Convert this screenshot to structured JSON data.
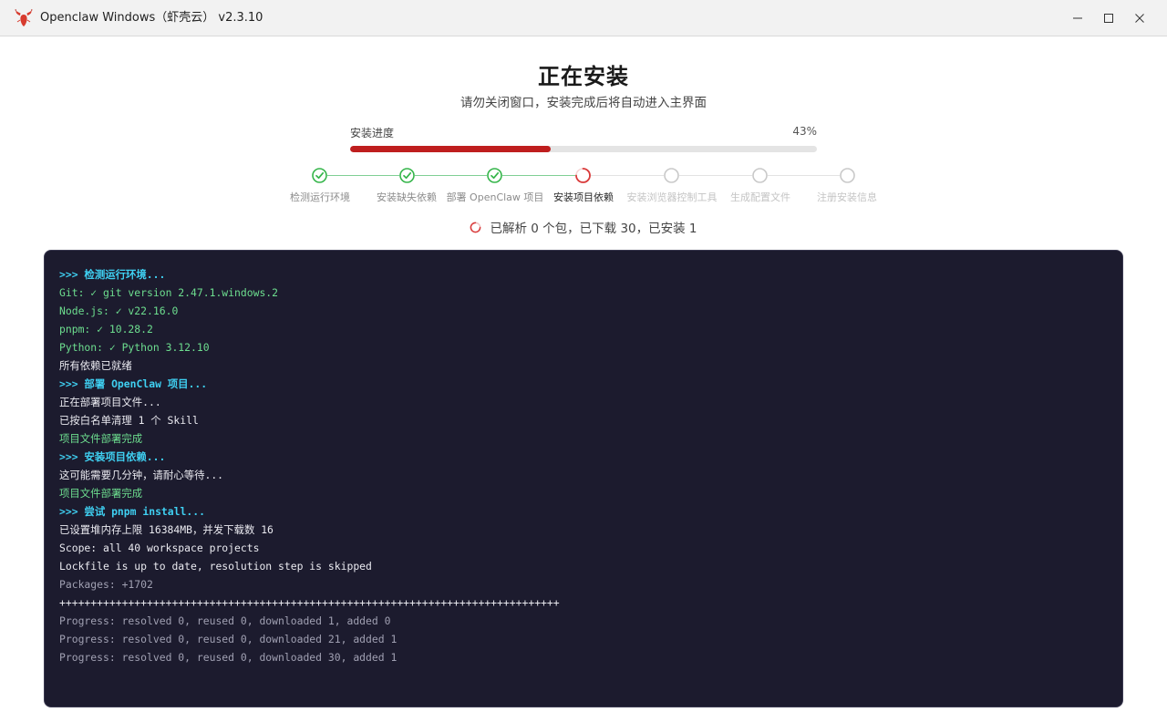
{
  "window": {
    "title": "Openclaw Windows（虾壳云） v2.3.10"
  },
  "header": {
    "title": "正在安装",
    "subtitle": "请勿关闭窗口，安装完成后将自动进入主界面"
  },
  "progress": {
    "label": "安装进度",
    "percent_text": "43%",
    "value": 0.43,
    "fill_color": "#bf1e1e"
  },
  "steps": [
    {
      "label": "检测运行环境",
      "status": "done"
    },
    {
      "label": "安装缺失依赖",
      "status": "done"
    },
    {
      "label": "部署 OpenClaw 项目",
      "status": "done"
    },
    {
      "label": "安装项目依赖",
      "status": "active"
    },
    {
      "label": "安装浏览器控制工具",
      "status": "pending"
    },
    {
      "label": "生成配置文件",
      "status": "pending"
    },
    {
      "label": "注册安装信息",
      "status": "pending"
    }
  ],
  "status_text": "已解析 0 个包，已下载 30，已安装 1",
  "colors": {
    "done": "#35b54a",
    "active": "#d93a3a",
    "pending": "#c9c9c9",
    "console_bg": "#1c1b2e"
  },
  "log": [
    {
      "text": ">>> 检测运行环境...",
      "style": "header"
    },
    {
      "text": "Git: ✓ git version 2.47.1.windows.2",
      "style": "green"
    },
    {
      "text": "Node.js: ✓ v22.16.0",
      "style": "green"
    },
    {
      "text": "pnpm: ✓ 10.28.2",
      "style": "green"
    },
    {
      "text": "Python: ✓ Python 3.12.10",
      "style": "green"
    },
    {
      "text": "所有依赖已就绪",
      "style": "white"
    },
    {
      "text": ">>> 部署 OpenClaw 项目...",
      "style": "header"
    },
    {
      "text": "正在部署项目文件...",
      "style": "white"
    },
    {
      "text": "已按白名单清理 1 个 Skill",
      "style": "white"
    },
    {
      "text": "项目文件部署完成",
      "style": "green"
    },
    {
      "text": ">>> 安装项目依赖...",
      "style": "header"
    },
    {
      "text": "这可能需要几分钟，请耐心等待...",
      "style": "white"
    },
    {
      "text": "项目文件部署完成",
      "style": "green"
    },
    {
      "text": ">>> 尝试 pnpm install...",
      "style": "header"
    },
    {
      "text": "已设置堆内存上限 16384MB，并发下载数 16",
      "style": "white"
    },
    {
      "text": "Scope: all 40 workspace projects",
      "style": "white"
    },
    {
      "text": "Lockfile is up to date, resolution step is skipped",
      "style": "white"
    },
    {
      "text": "Packages: +1702",
      "style": "gray"
    },
    {
      "text": "++++++++++++++++++++++++++++++++++++++++++++++++++++++++++++++++++++++++++++++++",
      "style": "white"
    },
    {
      "text": "Progress: resolved 0, reused 0, downloaded 1, added 0",
      "style": "gray"
    },
    {
      "text": "Progress: resolved 0, reused 0, downloaded 21, added 1",
      "style": "gray"
    },
    {
      "text": "Progress: resolved 0, reused 0, downloaded 30, added 1",
      "style": "gray"
    }
  ]
}
